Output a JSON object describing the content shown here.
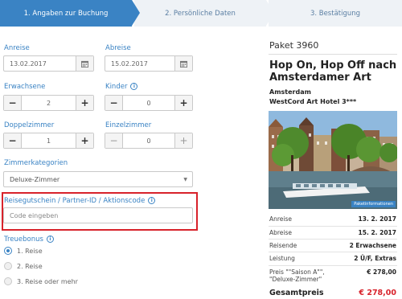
{
  "steps": [
    {
      "label": "1. Angaben zur Buchung"
    },
    {
      "label": "2. Persönliche Daten"
    },
    {
      "label": "3. Bestätigung"
    }
  ],
  "form": {
    "arrival_label": "Anreise",
    "arrival_value": "13.02.2017",
    "departure_label": "Abreise",
    "departure_value": "15.02.2017",
    "adults_label": "Erwachsene",
    "adults_value": "2",
    "children_label": "Kinder",
    "children_value": "0",
    "double_label": "Doppelzimmer",
    "double_value": "1",
    "single_label": "Einzelzimmer",
    "single_value": "0",
    "category_label": "Zimmerkategorien",
    "category_value": "Deluxe-Zimmer",
    "voucher_label": "Reisegutschein / Partner-ID / Aktionscode",
    "voucher_placeholder": "Code eingeben",
    "loyalty_label": "Treuebonus",
    "loyalty_options": [
      {
        "label": "1. Reise",
        "selected": true
      },
      {
        "label": "2. Reise",
        "selected": false
      },
      {
        "label": "3. Reise oder mehr",
        "selected": false
      }
    ],
    "minus_symbol": "−",
    "plus_symbol": "+",
    "info_symbol": "i",
    "caret_symbol": "▼"
  },
  "package": {
    "number": "Paket 3960",
    "title": "Hop On, Hop Off nach Amsterdamer Art",
    "city": "Amsterdam",
    "hotel": "WestCord Art Hotel  3***",
    "photo_badge": "Paketinformationen",
    "summary": [
      {
        "label": "Anreise",
        "value": "13. 2. 2017"
      },
      {
        "label": "Abreise",
        "value": "15. 2. 2017"
      },
      {
        "label": "Reisende",
        "value": "2 Erwachsene"
      },
      {
        "label": "Leistung",
        "value": "2 Ü/F, Extras"
      }
    ],
    "price_label": "Preis \"\"Saison A\"\", \"Deluxe-Zimmer\"",
    "price_value": "€ 278,00",
    "total_label": "Gesamtpreis",
    "total_value": "€ 278,00"
  },
  "colors": {
    "accent": "#3a83c4",
    "highlight": "#d8222b",
    "step_inactive": "#eef2f6"
  }
}
